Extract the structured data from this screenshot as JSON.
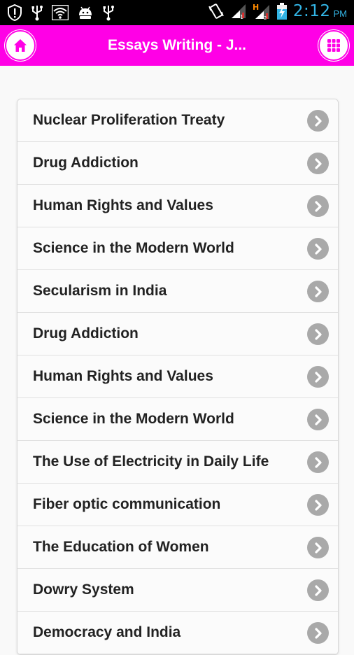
{
  "status_bar": {
    "time": "2:12",
    "ampm": "PM",
    "icons_left": [
      "alert-icon",
      "usb-icon",
      "wifi-icon",
      "android-icon",
      "usb-icon"
    ],
    "icons_right": [
      "vibrate-icon",
      "signal-icon",
      "hspa-signal-icon",
      "battery-charging-icon"
    ]
  },
  "app_bar": {
    "title": "Essays Writing - J...",
    "color": "#ff00e6"
  },
  "essays": [
    {
      "label": "Nuclear Proliferation Treaty"
    },
    {
      "label": "Drug Addiction"
    },
    {
      "label": "Human Rights and Values"
    },
    {
      "label": "Science in the Modern World"
    },
    {
      "label": "Secularism in India"
    },
    {
      "label": "Drug Addiction"
    },
    {
      "label": "Human Rights and Values"
    },
    {
      "label": "Science in the Modern World"
    },
    {
      "label": "The Use of Electricity in Daily Life"
    },
    {
      "label": "Fiber optic communication"
    },
    {
      "label": "The Education of Women"
    },
    {
      "label": "Dowry System"
    },
    {
      "label": "Democracy and India"
    }
  ]
}
